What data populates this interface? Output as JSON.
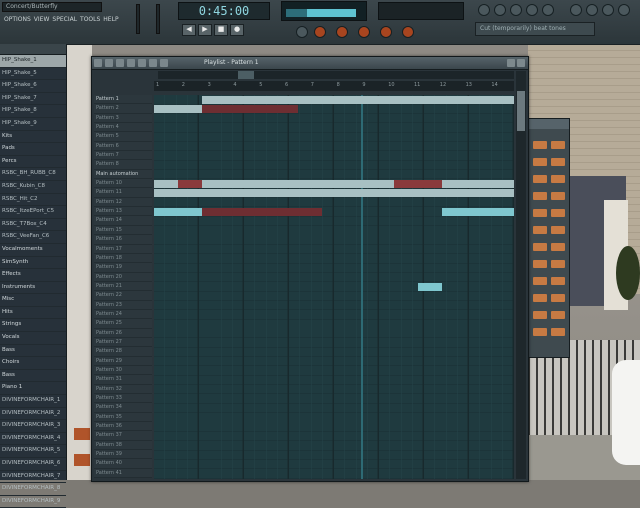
{
  "window_title": "Concert/Butterfly",
  "menu": [
    "OPTIONS",
    "VIEW",
    "SPECIAL",
    "TOOLS",
    "HELP"
  ],
  "time_display": "0:45:00",
  "snap_label": "Cut (temporarily) beat tones",
  "transport": [
    "◀",
    "▶",
    "■",
    "●"
  ],
  "browser": {
    "items": [
      {
        "label": "HIP_Shake_1",
        "type": "sel"
      },
      {
        "label": "HIP_Shake_5",
        "type": "item"
      },
      {
        "label": "HIP_Shake_6",
        "type": "item"
      },
      {
        "label": "HIP_Shake_7",
        "type": "item"
      },
      {
        "label": "HIP_Shake_8",
        "type": "item"
      },
      {
        "label": "HIP_Shake_9",
        "type": "item"
      },
      {
        "label": "Kits",
        "type": "folder"
      },
      {
        "label": "Pads",
        "type": "folder"
      },
      {
        "label": "Percs",
        "type": "folder"
      },
      {
        "label": "RSBC_BH_RUBB_C8",
        "type": "item"
      },
      {
        "label": "RSBC_Kubin_C8",
        "type": "item"
      },
      {
        "label": "RSBC_Hit_C2",
        "type": "item"
      },
      {
        "label": "RSBC_ItzeEPort_C5",
        "type": "item"
      },
      {
        "label": "RSBC_T7Box_C4",
        "type": "item"
      },
      {
        "label": "RSBC_VeeFan_C6",
        "type": "item"
      },
      {
        "label": "Vocalmoments",
        "type": "folder"
      },
      {
        "label": "SimSynth",
        "type": "folder"
      },
      {
        "label": "Effects",
        "type": "folder"
      },
      {
        "label": "Instruments",
        "type": "folder"
      },
      {
        "label": "Misc",
        "type": "folder"
      },
      {
        "label": "Hits",
        "type": "folder"
      },
      {
        "label": "Strings",
        "type": "folder"
      },
      {
        "label": "Vocals",
        "type": "folder"
      },
      {
        "label": "Bass",
        "type": "folder"
      },
      {
        "label": "Choirs",
        "type": "folder"
      },
      {
        "label": "Bass",
        "type": "folder"
      },
      {
        "label": "Piano 1",
        "type": "folder"
      },
      {
        "label": "DIVINEFORMCHAIR_1",
        "type": "item"
      },
      {
        "label": "DIVINEFORMCHAIR_2",
        "type": "item"
      },
      {
        "label": "DIVINEFORMCHAIR_3",
        "type": "item"
      },
      {
        "label": "DIVINEFORMCHAIR_4",
        "type": "item"
      },
      {
        "label": "DIVINEFORMCHAIR_5",
        "type": "item"
      },
      {
        "label": "DIVINEFORMCHAIR_6",
        "type": "item"
      },
      {
        "label": "DIVINEFORMCHAIR_7",
        "type": "item"
      },
      {
        "label": "DIVINEFORMCHAIR_8",
        "type": "item"
      },
      {
        "label": "DIVINEFORMCHAIR_9",
        "type": "item"
      }
    ]
  },
  "playlist": {
    "title": "Playlist - Pattern 1",
    "ruler": [
      "1",
      "2",
      "3",
      "4",
      "5",
      "6",
      "7",
      "8",
      "9",
      "10",
      "11",
      "12",
      "13",
      "14"
    ],
    "tracks": [
      "Pattern 1",
      "Pattern 2",
      "Pattern 3",
      "Pattern 4",
      "Pattern 5",
      "Pattern 6",
      "Pattern 7",
      "Pattern 8",
      "Main automation",
      "Pattern 10",
      "Pattern 11",
      "Pattern 12",
      "Pattern 13",
      "Pattern 14",
      "Pattern 15",
      "Pattern 16",
      "Pattern 17",
      "Pattern 18",
      "Pattern 19",
      "Pattern 20",
      "Pattern 21",
      "Pattern 22",
      "Pattern 23",
      "Pattern 24",
      "Pattern 25",
      "Pattern 26",
      "Pattern 27",
      "Pattern 28",
      "Pattern 29",
      "Pattern 30",
      "Pattern 31",
      "Pattern 32",
      "Pattern 33",
      "Pattern 34",
      "Pattern 35",
      "Pattern 36",
      "Pattern 37",
      "Pattern 38",
      "Pattern 39",
      "Pattern 40",
      "Pattern 41"
    ],
    "clips": [
      {
        "row": 0,
        "start": 2,
        "len": 13,
        "color": "lite"
      },
      {
        "row": 1,
        "start": 0,
        "len": 2,
        "color": "lite"
      },
      {
        "row": 1,
        "start": 2,
        "len": 4,
        "color": "dred"
      },
      {
        "row": 9,
        "start": 0,
        "len": 1,
        "color": "lite"
      },
      {
        "row": 9,
        "start": 1,
        "len": 1,
        "color": "red"
      },
      {
        "row": 9,
        "start": 2,
        "len": 8,
        "color": "lite"
      },
      {
        "row": 9,
        "start": 10,
        "len": 2,
        "color": "red"
      },
      {
        "row": 9,
        "start": 12,
        "len": 3,
        "color": "lite"
      },
      {
        "row": 10,
        "start": 0,
        "len": 15,
        "color": "lite"
      },
      {
        "row": 12,
        "start": 0,
        "len": 2,
        "color": "cyan"
      },
      {
        "row": 12,
        "start": 2,
        "len": 5,
        "color": "dred"
      },
      {
        "row": 12,
        "start": 12,
        "len": 3,
        "color": "cyan"
      },
      {
        "row": 20,
        "start": 11,
        "len": 1,
        "color": "cyan"
      }
    ]
  }
}
